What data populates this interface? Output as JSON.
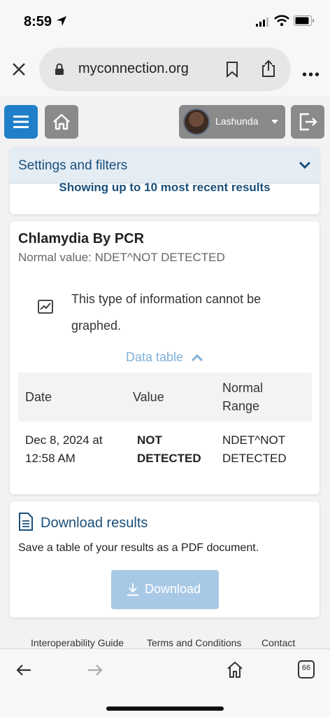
{
  "status_bar": {
    "time": "8:59"
  },
  "browser": {
    "url": "myconnection.org",
    "more_label": "•••"
  },
  "header": {
    "user_name": "Lashunda"
  },
  "settings": {
    "title": "Settings and filters",
    "subtitle": "Showing up to 10 most recent results"
  },
  "result": {
    "test_name": "Chlamydia By PCR",
    "normal_value": "Normal value: NDET^NOT DETECTED",
    "graph_note": "This type of information cannot be graphed.",
    "data_table_label": "Data table",
    "columns": {
      "date": "Date",
      "value": "Value",
      "normal_range": "Normal Range"
    },
    "rows": [
      {
        "date": "Dec 8, 2024 at 12:58 AM",
        "value": "NOT DETECTED",
        "normal_range": "NDET^NOT DETECTED"
      }
    ]
  },
  "download": {
    "title": "Download results",
    "description": "Save a table of your results as a PDF document.",
    "button_label": "Download"
  },
  "footer": {
    "links": [
      "Interoperability Guide",
      "Terms and Conditions",
      "Contact"
    ]
  },
  "toolbar": {
    "tab_count": "66"
  },
  "colors": {
    "primary": "#1f7fc9",
    "heading": "#1a4f7a",
    "link_light": "#7fb0d9",
    "button_disabled": "#a8c9e6"
  }
}
